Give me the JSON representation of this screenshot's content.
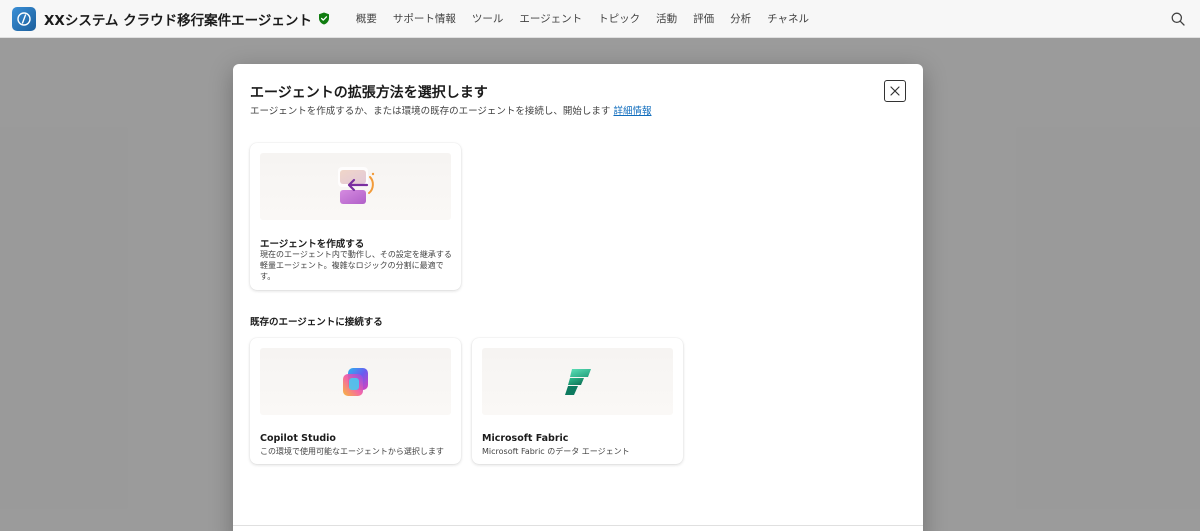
{
  "header": {
    "app_title": "XXシステム クラウド移行案件エージェント",
    "nav": [
      "概要",
      "サポート情報",
      "ツール",
      "エージェント",
      "トピック",
      "活動",
      "評価",
      "分析",
      "チャネル"
    ]
  },
  "dialog": {
    "title": "エージェントの拡張方法を選択します",
    "subtitle": "エージェントを作成するか、または環境の既存のエージェントを接続し、開始します",
    "learn_more": "詳細情報",
    "create_card": {
      "title": "エージェントを作成する",
      "description": "現在のエージェント内で動作し、その設定を継承する軽量エージェント。複雑なロジックの分割に最適です。"
    },
    "connect_section_label": "既存のエージェントに接続する",
    "connect_cards": [
      {
        "title": "Copilot Studio",
        "description": "この環境で使用可能なエージェントから選択します"
      },
      {
        "title": "Microsoft Fabric",
        "description": "Microsoft Fabric のデータ エージェント"
      }
    ]
  },
  "colors": {
    "accent": "#0f6cbd",
    "brand": "#1c5f9c",
    "shield": "#107c10"
  },
  "icons": [
    "app-icon",
    "verified-shield-icon",
    "search-icon",
    "close-icon",
    "create-agent-icon",
    "copilot-studio-icon",
    "microsoft-fabric-icon"
  ]
}
